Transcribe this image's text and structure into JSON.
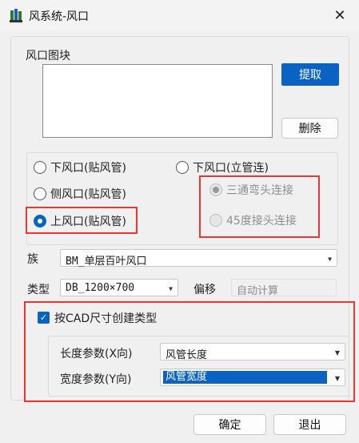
{
  "window": {
    "title": "风系统-风口",
    "close_glyph": "✕"
  },
  "outlet_block": {
    "label": "风口图块",
    "extract_button": "提取",
    "delete_button": "删除"
  },
  "outlet_types": {
    "lower_duct": "下风口(贴风管)",
    "lower_riser": "下风口(立管连)",
    "side_duct": "侧风口(贴风管)",
    "upper_duct": "上风口(贴风管)",
    "selected": "上风口(贴风管)"
  },
  "connection_options": {
    "tee_elbow": "三通弯头连接",
    "elbow_45": "45度接头连接",
    "selected": "三通弯头连接"
  },
  "family": {
    "label": "族",
    "value": "BM_单层百叶风口"
  },
  "type": {
    "label": "类型",
    "value": "DB_1200×700"
  },
  "offset": {
    "label": "偏移",
    "value": "自动计算"
  },
  "cad_size": {
    "label": "按CAD尺寸创建类型",
    "checked": true,
    "length_param_label": "长度参数(X向)",
    "length_param_value": "风管长度",
    "width_param_label": "宽度参数(Y向)",
    "width_param_value": "风管宽度"
  },
  "footer": {
    "ok_button": "确定",
    "exit_button": "退出"
  },
  "colors": {
    "accent": "#0a63c2",
    "highlight_border": "#e53935"
  },
  "icons": {
    "app": "ductwork-app-icon",
    "close": "close-icon",
    "dropdown": "chevron-down-icon",
    "check": "checkmark-icon"
  }
}
